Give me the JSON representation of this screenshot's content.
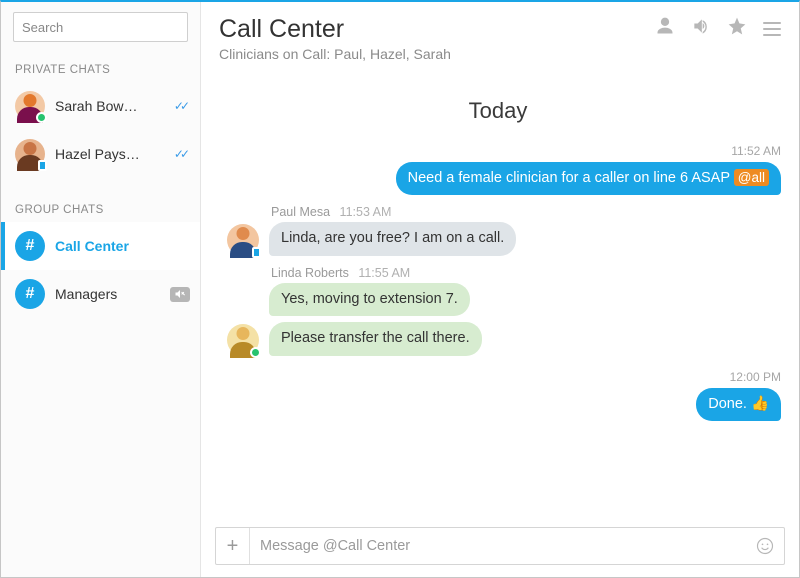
{
  "search": {
    "placeholder": "Search"
  },
  "sections": {
    "private": "PRIVATE CHATS",
    "group": "GROUP CHATS"
  },
  "private_chats": [
    {
      "name": "Sarah Bow…",
      "avatar_bg": "#e3782c",
      "avatar_body": "#7a0f4c",
      "status": "online"
    },
    {
      "name": "Hazel Pays…",
      "avatar_bg": "#c87445",
      "avatar_body": "#6a3a21",
      "status": "mobile"
    }
  ],
  "group_chats": [
    {
      "name": "Call Center",
      "active": true
    },
    {
      "name": "Managers",
      "muted": true
    }
  ],
  "header": {
    "title": "Call Center",
    "subtitle": "Clinicians on Call: Paul, Hazel, Sarah"
  },
  "day_label": "Today",
  "timestamps": {
    "first": "11:52 AM",
    "second": "12:00 PM"
  },
  "messages": {
    "outgoing1_text": "Need a female clinician for a caller on line 6 ASAP ",
    "outgoing1_mention": "@all",
    "paul_meta_name": "Paul Mesa",
    "paul_meta_time": "11:53 AM",
    "paul_text": "Linda, are you free? I am on a call.",
    "linda_meta_name": "Linda Roberts",
    "linda_meta_time": "11:55 AM",
    "linda_text1": "Yes, moving to extension 7.",
    "linda_text2": "Please transfer the call there.",
    "outgoing2_text": "Done. 👍"
  },
  "composer": {
    "placeholder": "Message @Call Center"
  },
  "hash": "#"
}
